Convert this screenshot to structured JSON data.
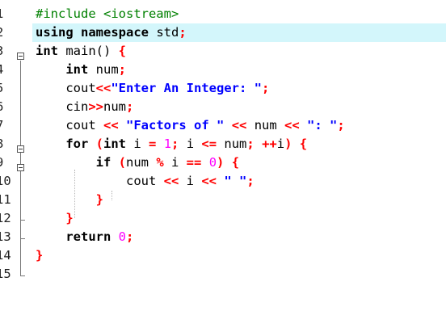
{
  "editor": {
    "highlighted_line": 2,
    "lines": [
      {
        "num": "1",
        "tokens": [
          {
            "t": "#include <iostream>",
            "c": "pp"
          }
        ]
      },
      {
        "num": "2",
        "tokens": [
          {
            "t": "using namespace",
            "c": "kwt"
          },
          {
            "t": " std",
            "c": ""
          },
          {
            "t": ";",
            "c": "op"
          }
        ]
      },
      {
        "num": "3",
        "tokens": [
          {
            "t": "int",
            "c": "kwt"
          },
          {
            "t": " main",
            "c": ""
          },
          {
            "t": "()",
            "c": ""
          },
          {
            "t": " {",
            "c": "op"
          }
        ]
      },
      {
        "num": "4",
        "tokens": [
          {
            "t": "    ",
            "c": ""
          },
          {
            "t": "int",
            "c": "kwt"
          },
          {
            "t": " num",
            "c": ""
          },
          {
            "t": ";",
            "c": "op"
          }
        ]
      },
      {
        "num": "5",
        "tokens": [
          {
            "t": "    cout",
            "c": ""
          },
          {
            "t": "<<",
            "c": "op"
          },
          {
            "t": "\"Enter An Integer: \"",
            "c": "str"
          },
          {
            "t": ";",
            "c": "op"
          }
        ]
      },
      {
        "num": "6",
        "tokens": [
          {
            "t": "    cin",
            "c": ""
          },
          {
            "t": ">>",
            "c": "op"
          },
          {
            "t": "num",
            "c": ""
          },
          {
            "t": ";",
            "c": "op"
          }
        ]
      },
      {
        "num": "7",
        "tokens": [
          {
            "t": "    cout ",
            "c": ""
          },
          {
            "t": "<<",
            "c": "op"
          },
          {
            "t": " ",
            "c": ""
          },
          {
            "t": "\"Factors of \"",
            "c": "str"
          },
          {
            "t": " ",
            "c": ""
          },
          {
            "t": "<<",
            "c": "op"
          },
          {
            "t": " num ",
            "c": ""
          },
          {
            "t": "<<",
            "c": "op"
          },
          {
            "t": " ",
            "c": ""
          },
          {
            "t": "\": \"",
            "c": "str"
          },
          {
            "t": ";",
            "c": "op"
          }
        ]
      },
      {
        "num": "8",
        "tokens": [
          {
            "t": "    ",
            "c": ""
          },
          {
            "t": "for",
            "c": "kwt"
          },
          {
            "t": " (",
            "c": "op"
          },
          {
            "t": "int",
            "c": "kwt"
          },
          {
            "t": " i ",
            "c": ""
          },
          {
            "t": "=",
            "c": "op"
          },
          {
            "t": " ",
            "c": ""
          },
          {
            "t": "1",
            "c": "num"
          },
          {
            "t": ";",
            "c": "op"
          },
          {
            "t": " i ",
            "c": ""
          },
          {
            "t": "<=",
            "c": "op"
          },
          {
            "t": " num",
            "c": ""
          },
          {
            "t": ";",
            "c": "op"
          },
          {
            "t": " ",
            "c": ""
          },
          {
            "t": "++",
            "c": "op"
          },
          {
            "t": "i",
            "c": ""
          },
          {
            "t": ")",
            "c": "op"
          },
          {
            "t": " {",
            "c": "op"
          }
        ]
      },
      {
        "num": "9",
        "tokens": [
          {
            "t": "        ",
            "c": ""
          },
          {
            "t": "if",
            "c": "kwt"
          },
          {
            "t": " (",
            "c": "op"
          },
          {
            "t": "num ",
            "c": ""
          },
          {
            "t": "%",
            "c": "op"
          },
          {
            "t": " i ",
            "c": ""
          },
          {
            "t": "==",
            "c": "op"
          },
          {
            "t": " ",
            "c": ""
          },
          {
            "t": "0",
            "c": "num"
          },
          {
            "t": ")",
            "c": "op"
          },
          {
            "t": " {",
            "c": "op"
          }
        ]
      },
      {
        "num": "10",
        "tokens": [
          {
            "t": "            cout ",
            "c": ""
          },
          {
            "t": "<<",
            "c": "op"
          },
          {
            "t": " i ",
            "c": ""
          },
          {
            "t": "<<",
            "c": "op"
          },
          {
            "t": " ",
            "c": ""
          },
          {
            "t": "\" \"",
            "c": "str"
          },
          {
            "t": ";",
            "c": "op"
          }
        ]
      },
      {
        "num": "11",
        "tokens": [
          {
            "t": "        ",
            "c": ""
          },
          {
            "t": "}",
            "c": "op"
          }
        ]
      },
      {
        "num": "12",
        "tokens": [
          {
            "t": "    ",
            "c": ""
          },
          {
            "t": "}",
            "c": "op"
          }
        ]
      },
      {
        "num": "13",
        "tokens": [
          {
            "t": "    ",
            "c": ""
          },
          {
            "t": "return",
            "c": "kwt"
          },
          {
            "t": " ",
            "c": ""
          },
          {
            "t": "0",
            "c": "num"
          },
          {
            "t": ";",
            "c": "op"
          }
        ]
      },
      {
        "num": "14",
        "tokens": [
          {
            "t": "}",
            "c": "op"
          }
        ]
      },
      {
        "num": "15",
        "tokens": []
      }
    ]
  }
}
